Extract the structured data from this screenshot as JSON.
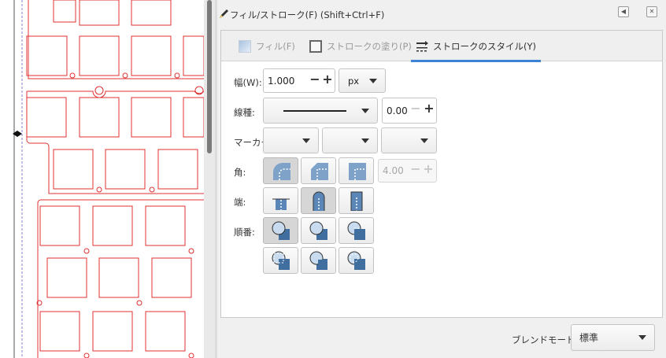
{
  "title": "フィル/ストローク(F) (Shift+Ctrl+F)",
  "title_buttons": [
    "◀",
    "✕"
  ],
  "tabs": [
    {
      "label": "フィル(F)",
      "icon": "fill-swatch-icon",
      "active": false
    },
    {
      "label": "ストロークの塗り(P)",
      "icon": "stroke-paint-icon",
      "active": false
    },
    {
      "label": "ストロークのスタイル(Y)",
      "icon": "stroke-style-icon",
      "active": true
    }
  ],
  "stroke_style": {
    "width_label": "幅(W):",
    "width_value": "1.000",
    "unit": "px",
    "dash_label": "線種:",
    "dash_offset": "0.00",
    "markers_label": "マーカー:",
    "join_label": "角:",
    "miter_limit": "4.00",
    "cap_label": "端:",
    "order_label": "順番:",
    "minus": "−",
    "plus": "+"
  },
  "blend": {
    "label": "ブレンドモード:",
    "value": "標準"
  },
  "colors": {
    "accent": "#3d83d5",
    "outline_red": "#e03030",
    "icon_blue": "#5b87b8"
  }
}
